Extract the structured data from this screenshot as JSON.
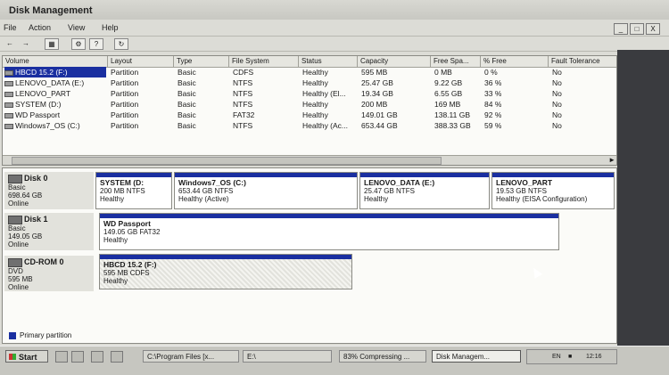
{
  "window": {
    "title": "Disk Management"
  },
  "menu": [
    "File",
    "Action",
    "View",
    "Help"
  ],
  "window_buttons": [
    "_",
    "□",
    "X"
  ],
  "toolbar": [
    "back-icon",
    "forward-icon",
    "view-icon",
    "properties-icon",
    "help-icon",
    "refresh-icon"
  ],
  "columns": [
    "Volume",
    "Layout",
    "Type",
    "File System",
    "Status",
    "Capacity",
    "Free Spa...",
    "% Free",
    "Fault Tolerance"
  ],
  "volumes": [
    [
      "HBCD 15.2 (F:)",
      "Partition",
      "Basic",
      "CDFS",
      "Healthy",
      "595 MB",
      "0 MB",
      "0 %",
      "No"
    ],
    [
      "LENOVO_DATA (E:)",
      "Partition",
      "Basic",
      "NTFS",
      "Healthy",
      "25.47 GB",
      "9.22 GB",
      "36 %",
      "No"
    ],
    [
      "LENOVO_PART",
      "Partition",
      "Basic",
      "NTFS",
      "Healthy (El...",
      "19.34 GB",
      "6.55 GB",
      "33 %",
      "No"
    ],
    [
      "SYSTEM (D:)",
      "Partition",
      "Basic",
      "NTFS",
      "Healthy",
      "200 MB",
      "169 MB",
      "84 %",
      "No"
    ],
    [
      "WD Passport",
      "Partition",
      "Basic",
      "FAT32",
      "Healthy",
      "149.01 GB",
      "138.11 GB",
      "92 %",
      "No"
    ],
    [
      "Windows7_OS (C:)",
      "Partition",
      "Basic",
      "NTFS",
      "Healthy (Ac...",
      "653.44 GB",
      "388.33 GB",
      "59 %",
      "No"
    ]
  ],
  "disks": [
    {
      "name": "Disk 0",
      "type": "Basic",
      "size": "698.64 GB",
      "state": "Online",
      "partitions": [
        {
          "name": "SYSTEM  (D:",
          "detail": "200 MB NTFS",
          "status": "Healthy"
        },
        {
          "name": "Windows7_OS  (C:)",
          "detail": "653.44 GB NTFS",
          "status": "Healthy (Active)"
        },
        {
          "name": "LENOVO_DATA  (E:)",
          "detail": "25.47 GB NTFS",
          "status": "Healthy"
        },
        {
          "name": "LENOVO_PART",
          "detail": "19.53 GB NTFS",
          "status": "Healthy (EISA Configuration)"
        }
      ]
    },
    {
      "name": "Disk 1",
      "type": "Basic",
      "size": "149.05 GB",
      "state": "Online",
      "partitions": [
        {
          "name": "WD Passport",
          "detail": "149.05 GB FAT32",
          "status": "Healthy"
        }
      ]
    },
    {
      "name": "CD-ROM 0",
      "type": "DVD",
      "size": "595 MB",
      "state": "Online",
      "partitions": [
        {
          "name": "HBCD 15.2  (F:)",
          "detail": "595 MB CDFS",
          "status": "Healthy"
        }
      ]
    }
  ],
  "legend": {
    "label": "Primary partition",
    "color": "#1a2fa0"
  },
  "taskbar": {
    "start": "Start",
    "tasks": [
      "C:\\Program Files [x...",
      "E:\\",
      "83% Compressing ...",
      "Disk Managem..."
    ],
    "tray_lang": "EN",
    "clock": "12:16"
  }
}
